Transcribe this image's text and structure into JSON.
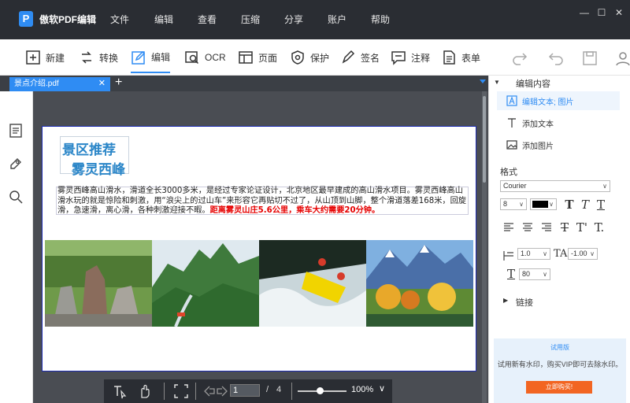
{
  "app": {
    "name": "傲软PDF编辑",
    "menus": [
      "文件",
      "编辑",
      "查看",
      "压缩",
      "分享",
      "账户",
      "帮助"
    ]
  },
  "toolbar": {
    "tools": [
      "新建",
      "转换",
      "编辑",
      "OCR",
      "页面",
      "保护",
      "签名",
      "注释",
      "表单"
    ],
    "active_tool": "编辑"
  },
  "tabs": {
    "current": "景点介绍.pdf"
  },
  "document": {
    "heading_line1": "景区推荐",
    "heading_line2": "雾灵西峰",
    "paragraph": "雾灵西峰高山滑水，滑道全长3000多米，是经过专家论证设计，北京地区最早建成的高山滑水项目。雾灵西峰高山滑水玩的就是惊险和刺激，用“浪尖上的过山车”来形容它再贴切不过了，从山顶到山脚，整个滑道落差168米，回旋滑，急速滑，离心滑，各种刺激迎接不暇。",
    "paragraph_highlight": "距离雾灵山庄5.6公里，乘车大约需要20分钟。"
  },
  "navigation": {
    "current_page": "1",
    "separator": "/",
    "total_pages": "4",
    "zoom": "100%",
    "zoom_level": 0.45
  },
  "panel": {
    "edit_section_title": "编辑内容",
    "items": [
      "编辑文本; 图片",
      "添加文本",
      "添加图片"
    ],
    "format_title": "格式",
    "font": "Courier",
    "font_size": "8",
    "font_color": "#000000",
    "line_spacing": "1.0",
    "char_spacing": "-1.00",
    "scale": "80",
    "link_section_title": "链接",
    "trial_title": "试用版",
    "trial_text": "试用新有水印，购买VIP即可去除水印。",
    "buy_button": "立即购买!"
  },
  "colors": {
    "accent": "#2f8cf3",
    "titlebar": "#2a2d33",
    "highlight_text": "#e60000",
    "buy_button": "#f26522"
  }
}
